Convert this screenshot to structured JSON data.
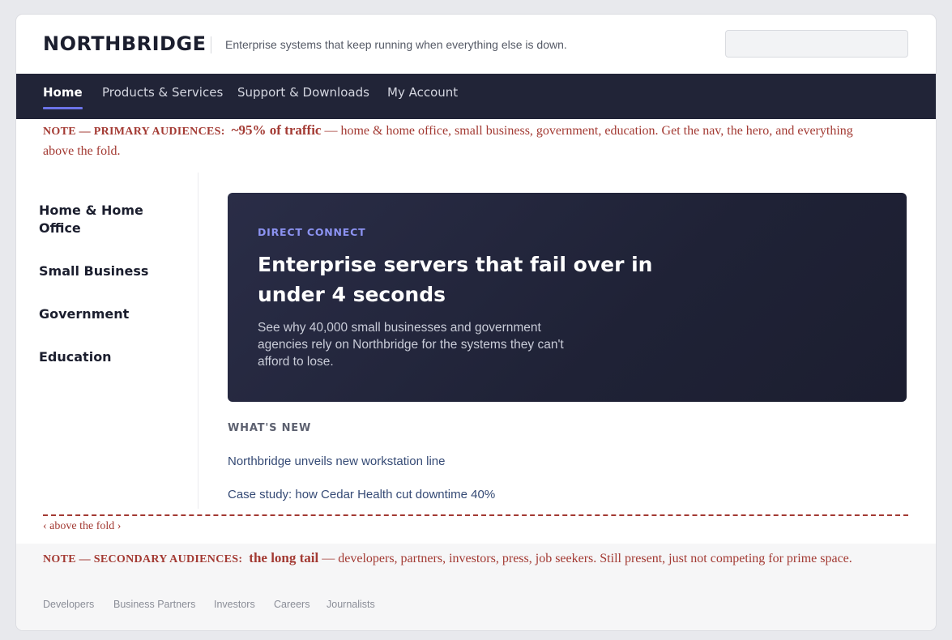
{
  "header": {
    "logo": "NORTHBRIDGE",
    "tagline": "Enterprise systems that keep running when everything else is down.",
    "search_placeholder": ""
  },
  "nav": {
    "items": [
      {
        "label": "Home",
        "active": true
      },
      {
        "label": "Products & Services",
        "active": false
      },
      {
        "label": "Support & Downloads",
        "active": false
      },
      {
        "label": "My Account",
        "active": false
      }
    ]
  },
  "note_primary": {
    "label": "NOTE — PRIMARY AUDIENCES:",
    "emphasis": "~95% of traffic",
    "text": "— home & home office, small business, government, education. Get the nav, the hero, and everything above the fold."
  },
  "sidebar": {
    "items": [
      {
        "label": "Home & Home Office"
      },
      {
        "label": "Small Business"
      },
      {
        "label": "Government"
      },
      {
        "label": "Education"
      }
    ]
  },
  "hero": {
    "eyebrow": "DIRECT CONNECT",
    "title": "Enterprise servers that fail over in under 4 seconds",
    "body": "See why 40,000 small businesses and government agencies rely on Northbridge for the systems they can't afford to lose."
  },
  "whats_new": {
    "heading": "WHAT'S NEW",
    "items": [
      {
        "label": "Northbridge unveils new workstation line"
      },
      {
        "label": "Case study: how Cedar Health cut downtime 40%"
      }
    ]
  },
  "fold": {
    "label": "‹ above the fold ›"
  },
  "note_secondary": {
    "label": "NOTE — SECONDARY AUDIENCES:",
    "emphasis": "the long tail",
    "text": "— developers, partners, investors, press, job seekers. Still present, just not competing for prime space."
  },
  "footer": {
    "links": [
      {
        "label": "Developers"
      },
      {
        "label": "Business Partners"
      },
      {
        "label": "Investors"
      },
      {
        "label": "Careers"
      },
      {
        "label": "Journalists"
      }
    ]
  },
  "colors": {
    "nav_bg": "#212437",
    "accent": "#6b73e8",
    "note": "#a33a33",
    "hero_bg": "#1f2236"
  }
}
